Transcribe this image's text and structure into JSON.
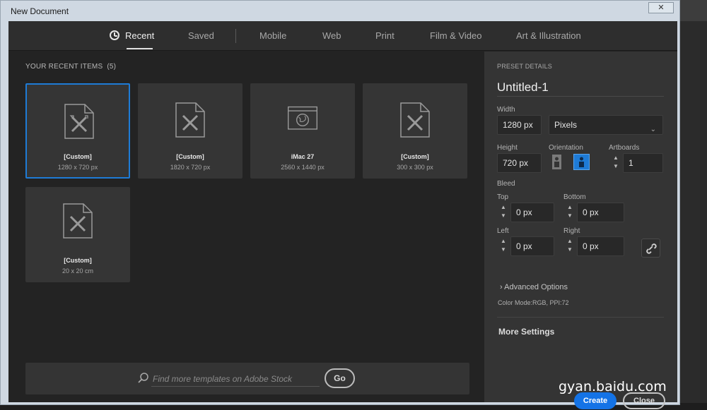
{
  "window": {
    "title": "New Document",
    "close_glyph": "✕"
  },
  "tabs": [
    {
      "label": "Recent",
      "active": true,
      "icon": "clock-icon"
    },
    {
      "label": "Saved"
    },
    {
      "label": "Mobile"
    },
    {
      "label": "Web"
    },
    {
      "label": "Print"
    },
    {
      "label": "Film & Video"
    },
    {
      "label": "Art & Illustration"
    }
  ],
  "recent": {
    "heading": "YOUR RECENT ITEMS",
    "count": "(5)",
    "items": [
      {
        "name": "[Custom]",
        "size": "1280 x 720 px",
        "icon": "custom-doc-icon",
        "selected": true
      },
      {
        "name": "[Custom]",
        "size": "1820 x 720 px",
        "icon": "custom-doc-icon"
      },
      {
        "name": "iMac 27",
        "size": "2560 x 1440 px",
        "icon": "web-browser-icon"
      },
      {
        "name": "[Custom]",
        "size": "300 x 300 px",
        "icon": "custom-doc-icon"
      },
      {
        "name": "[Custom]",
        "size": "20 x 20 cm",
        "icon": "custom-doc-icon"
      }
    ]
  },
  "stock": {
    "placeholder": "Find more templates on Adobe Stock",
    "go_label": "Go"
  },
  "preset": {
    "heading": "PRESET DETAILS",
    "name": "Untitled-1",
    "width_label": "Width",
    "width_value": "1280 px",
    "units": "Pixels",
    "height_label": "Height",
    "height_value": "720 px",
    "orientation_label": "Orientation",
    "artboards_label": "Artboards",
    "artboards_value": "1",
    "bleed_label": "Bleed",
    "top_label": "Top",
    "top_value": "0 px",
    "bottom_label": "Bottom",
    "bottom_value": "0 px",
    "left_label": "Left",
    "left_value": "0 px",
    "right_label": "Right",
    "right_value": "0 px",
    "advanced_label": "Advanced Options",
    "color_mode": "Color Mode:RGB, PPI:72",
    "more_settings": "More Settings",
    "create_label": "Create",
    "close_label": "Close"
  },
  "watermark": "gyan.baidu.com",
  "colors": {
    "accent": "#1e7bd6",
    "create": "#1473e6",
    "dialog_bg": "#232323",
    "panel_bg": "#343434"
  }
}
